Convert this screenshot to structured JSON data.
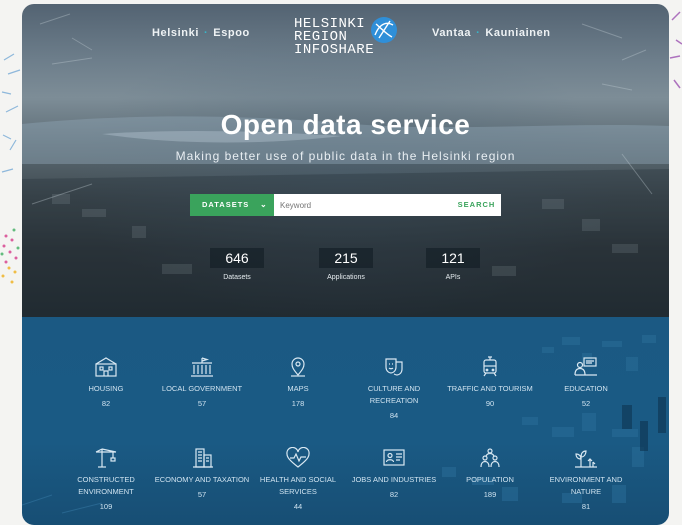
{
  "nav": {
    "left": [
      "Helsinki",
      "Espoo"
    ],
    "right": [
      "Vantaa",
      "Kauniainen"
    ]
  },
  "logo": {
    "line1": "HELSINKI",
    "line2": "REGION",
    "line3": "INFOSHARE"
  },
  "hero": {
    "title": "Open data service",
    "subtitle": "Making better use of public data in the Helsinki region"
  },
  "search": {
    "dropdown_label": "DATASETS",
    "placeholder": "Keyword",
    "button_label": "SEARCH"
  },
  "stats": [
    {
      "value": "646",
      "label": "Datasets"
    },
    {
      "value": "215",
      "label": "Applications"
    },
    {
      "value": "121",
      "label": "APIs"
    }
  ],
  "categories": [
    {
      "label": "HOUSING",
      "count": "82",
      "icon": "housing-icon"
    },
    {
      "label": "LOCAL GOVERNMENT",
      "count": "57",
      "icon": "government-building-icon"
    },
    {
      "label": "MAPS",
      "count": "178",
      "icon": "map-pin-icon"
    },
    {
      "label": "CULTURE AND RECREATION",
      "count": "84",
      "icon": "theatre-masks-icon"
    },
    {
      "label": "TRAFFIC AND TOURISM",
      "count": "90",
      "icon": "tram-icon"
    },
    {
      "label": "EDUCATION",
      "count": "52",
      "icon": "education-icon"
    },
    {
      "label": "CONSTRUCTED ENVIRONMENT",
      "count": "109",
      "icon": "crane-icon"
    },
    {
      "label": "ECONOMY AND TAXATION",
      "count": "57",
      "icon": "office-building-icon"
    },
    {
      "label": "HEALTH AND SOCIAL SERVICES",
      "count": "44",
      "icon": "heart-pulse-icon"
    },
    {
      "label": "JOBS AND INDUSTRIES",
      "count": "82",
      "icon": "id-card-icon"
    },
    {
      "label": "POPULATION",
      "count": "189",
      "icon": "people-icon"
    },
    {
      "label": "ENVIRONMENT AND NATURE",
      "count": "81",
      "icon": "plant-icon"
    }
  ],
  "colors": {
    "accent_green": "#3aa35c",
    "brand_teal": "#38b6c9",
    "category_panel": "#1a5a84"
  }
}
